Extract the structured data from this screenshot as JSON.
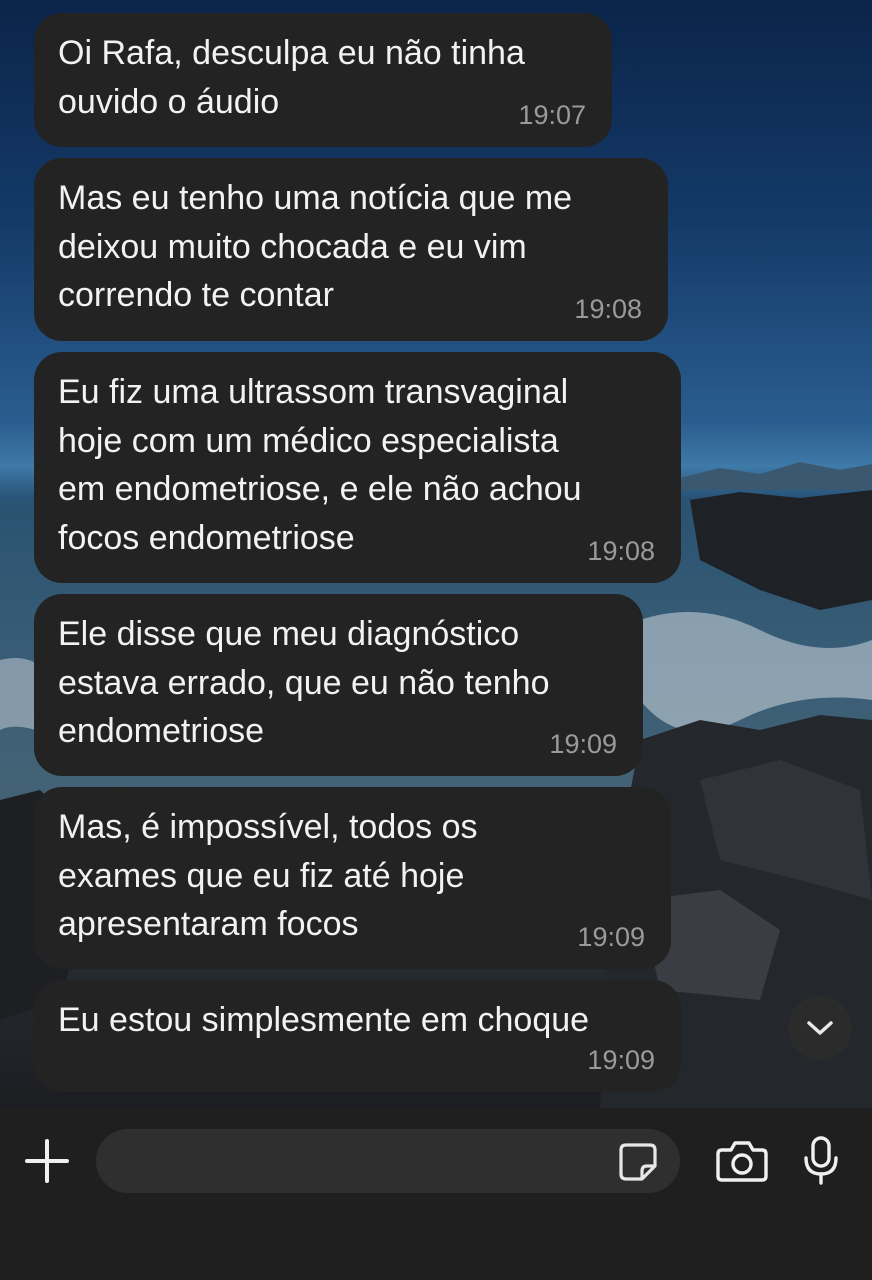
{
  "messages": [
    {
      "text": "Oi Rafa, desculpa eu não tinha\nouvido o áudio",
      "time": "19:07"
    },
    {
      "text": "Mas eu tenho uma notícia que me\ndeixou muito chocada e eu vim\ncorrendo te contar",
      "time": "19:08"
    },
    {
      "text": "Eu fiz uma ultrassom transvaginal\nhoje com um médico especialista\nem endometriose, e ele não achou\nfocos endometriose",
      "time": "19:08"
    },
    {
      "text": "Ele disse que meu diagnóstico\nestava errado, que eu não tenho\nendometriose",
      "time": "19:09"
    },
    {
      "text": "Mas, é impossível, todos os\nexames que eu fiz até hoje\napresentaram focos",
      "time": "19:09"
    },
    {
      "text": "Eu estou simplesmente em choque",
      "time": "19:09"
    }
  ],
  "composer": {
    "input_value": "",
    "input_placeholder": ""
  },
  "icons": {
    "plus": "plus-icon",
    "sticker": "sticker-icon",
    "camera": "camera-icon",
    "mic": "microphone-icon",
    "scroll": "chevron-down-icon"
  },
  "colors": {
    "bubble": "#232323",
    "text": "#f2f2f2",
    "time": "#9a9a9a",
    "composer": "#1f1f1f"
  }
}
